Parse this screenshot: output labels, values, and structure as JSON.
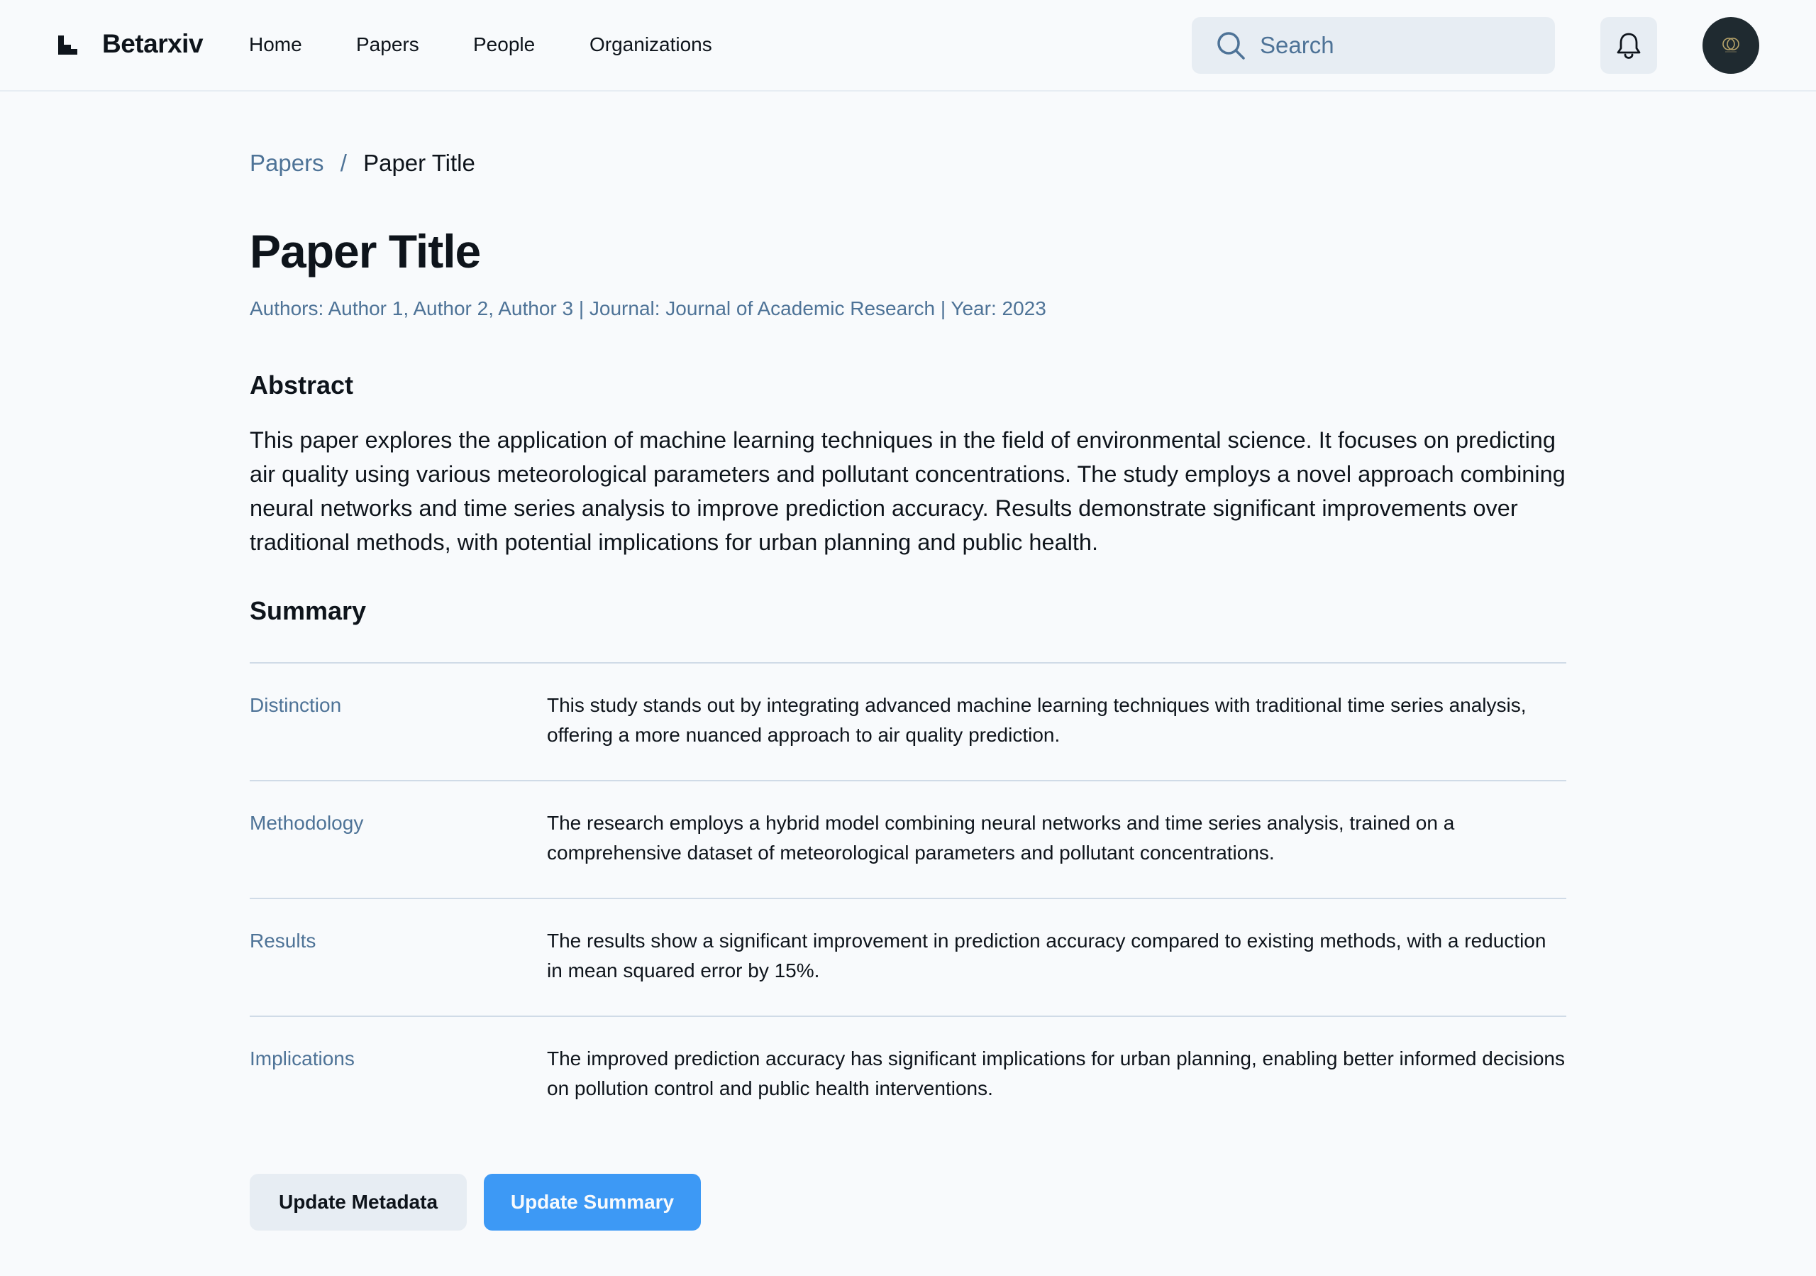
{
  "header": {
    "brand_name": "Betarxiv",
    "logo_icon": "betarxiv-logo-icon",
    "nav": [
      {
        "label": "Home"
      },
      {
        "label": "Papers"
      },
      {
        "label": "People"
      },
      {
        "label": "Organizations"
      }
    ],
    "search": {
      "placeholder": "Search",
      "value": "",
      "icon": "search-icon"
    },
    "notifications_icon": "bell-icon",
    "avatar_icon": "avatar"
  },
  "breadcrumb": {
    "parent": "Papers",
    "separator": "/",
    "current": "Paper Title"
  },
  "paper": {
    "title": "Paper Title",
    "meta": "Authors: Author 1, Author 2, Author 3 | Journal: Journal of Academic Research | Year: 2023",
    "abstract_heading": "Abstract",
    "abstract": "This paper explores the application of machine learning techniques in the field of environmental science. It focuses on predicting air quality using various meteorological parameters and pollutant concentrations. The study employs a novel approach combining neural networks and time series analysis to improve prediction accuracy. Results demonstrate significant improvements over traditional methods, with potential implications for urban planning and public health.",
    "summary_heading": "Summary",
    "summary": [
      {
        "label": "Distinction",
        "text": "This study stands out by integrating advanced machine learning techniques with traditional time series analysis, offering a more nuanced approach to air quality prediction."
      },
      {
        "label": "Methodology",
        "text": "The research employs a hybrid model combining neural networks and time series analysis, trained on a comprehensive dataset of meteorological parameters and pollutant concentrations."
      },
      {
        "label": "Results",
        "text": "The results show a significant improvement in prediction accuracy compared to existing methods, with a reduction in mean squared error by 15%."
      },
      {
        "label": "Implications",
        "text": "The improved prediction accuracy has significant implications for urban planning, enabling better informed decisions on pollution control and public health interventions."
      }
    ]
  },
  "actions": {
    "update_metadata": "Update Metadata",
    "update_summary": "Update Summary"
  },
  "colors": {
    "background": "#f8fafc",
    "text_primary": "#0e141b",
    "text_secondary": "#4e7397",
    "surface": "#e7edf3",
    "divider": "#d0dbe7",
    "accent": "#3d99f5"
  }
}
